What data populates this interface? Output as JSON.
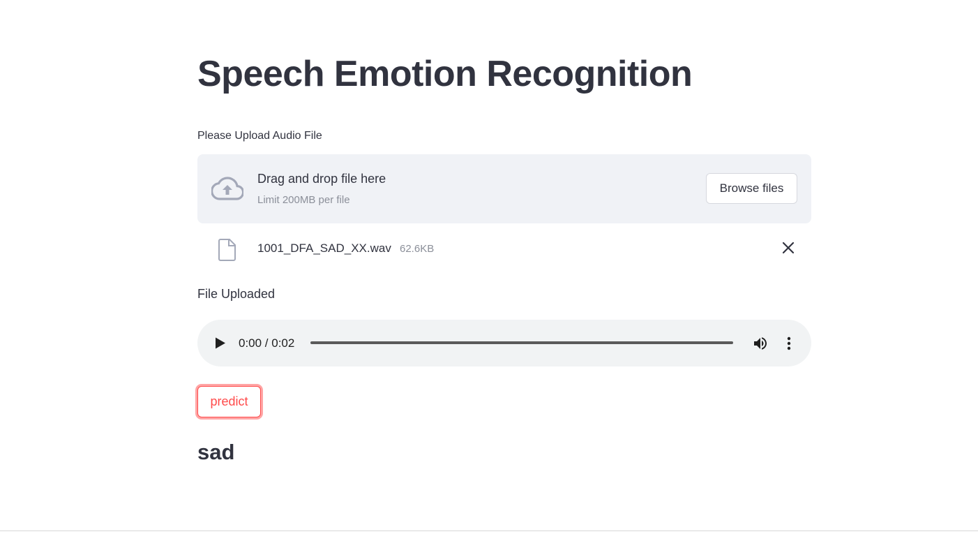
{
  "app": {
    "title": "Speech Emotion Recognition"
  },
  "uploader": {
    "label": "Please Upload Audio File",
    "drag_text": "Drag and drop file here",
    "limit_text": "Limit 200MB per file",
    "browse_label": "Browse files",
    "icon": "cloud-upload-icon"
  },
  "uploaded_file": {
    "name": "1001_DFA_SAD_XX.wav",
    "size": "62.6KB",
    "icon": "file-icon"
  },
  "status_text": "File Uploaded",
  "audio_player": {
    "time": "0:00 / 0:02",
    "progress": 0
  },
  "predict_button": {
    "label": "predict"
  },
  "result": {
    "emotion": "sad"
  },
  "colors": {
    "text": "#31333f",
    "accent": "#ff4b4b",
    "secondary_bg": "#f0f2f6",
    "muted": "#8b8f99"
  }
}
